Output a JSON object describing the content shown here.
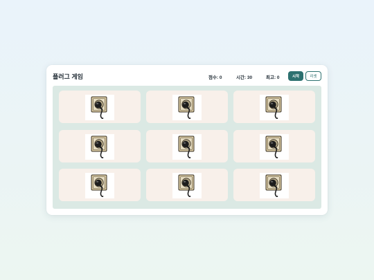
{
  "game": {
    "title": "플러그 게임",
    "score": "점수: 0",
    "time": "시간: 30",
    "best": "최고: 0",
    "start_label": "시작",
    "reset_label": "리셋"
  },
  "board": {
    "rows": 3,
    "cols": 3,
    "cell_icon": "plug-socket-icon"
  },
  "colors": {
    "accent": "#2d7170",
    "board_bg": "#dbe9e4",
    "cell_bg": "#f8f0ea"
  }
}
